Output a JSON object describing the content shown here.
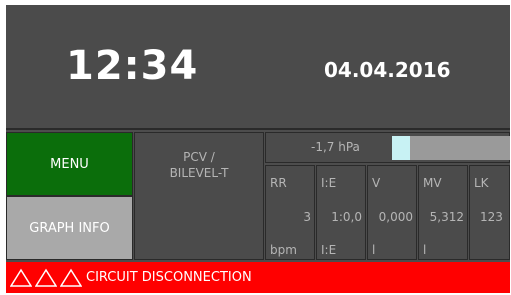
{
  "header": {
    "time": "12:34",
    "date": "04.04.2016"
  },
  "buttons": {
    "menu_label": "MENU",
    "graph_label": "GRAPH INFO"
  },
  "mode": {
    "line1": "PCV /",
    "line2": "BILEVEL-T"
  },
  "pressure": {
    "label": "-1,7 hPa",
    "fill_fraction": 0.15
  },
  "params": [
    {
      "name": "RR",
      "value": "3",
      "unit": "bpm"
    },
    {
      "name": "I:E",
      "value": "1:0,0",
      "unit": "I:E"
    },
    {
      "name": "V",
      "value": "0,000",
      "unit": "l"
    },
    {
      "name": "MV",
      "value": "5,312",
      "unit": "l"
    },
    {
      "name": "LK",
      "value": "123",
      "unit": ""
    }
  ],
  "alarm": {
    "text": "CIRCUIT DISCONNECTION",
    "icon": "warning-triangle-icon",
    "icon_count": 3
  },
  "colors": {
    "background": "#4b4b4b",
    "menu_green": "#0b6e0b",
    "graph_gray": "#a9a9a9",
    "alarm_red": "#ff0000",
    "pressure_fill": "#c8f2f4"
  }
}
